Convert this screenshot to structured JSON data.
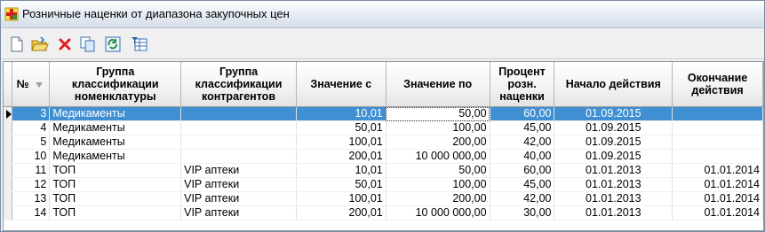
{
  "window": {
    "title": "Розничные наценки от диапазона закупочных цен"
  },
  "toolbar": {
    "buttons": [
      {
        "name": "new-icon"
      },
      {
        "name": "open-folder-icon"
      },
      {
        "name": "delete-icon"
      },
      {
        "name": "copy-icon"
      },
      {
        "name": "refresh-icon"
      },
      {
        "name": "filter-table-icon"
      }
    ]
  },
  "table": {
    "columns": [
      {
        "label": "№"
      },
      {
        "label": "Группа классификации номенклатуры"
      },
      {
        "label": "Группа классификации контрагентов"
      },
      {
        "label": "Значение с"
      },
      {
        "label": "Значение по"
      },
      {
        "label": "Процент розн. наценки"
      },
      {
        "label": "Начало действия"
      },
      {
        "label": "Окончание действия"
      }
    ],
    "selected_row": 0,
    "rows": [
      {
        "no": "3",
        "nom_group": "Медикаменты",
        "contr_group": "",
        "from": "10,01",
        "to": "50,00",
        "percent": "60,00",
        "start": "01.09.2015",
        "end": ""
      },
      {
        "no": "4",
        "nom_group": "Медикаменты",
        "contr_group": "",
        "from": "50,01",
        "to": "100,00",
        "percent": "45,00",
        "start": "01.09.2015",
        "end": ""
      },
      {
        "no": "5",
        "nom_group": "Медикаменты",
        "contr_group": "",
        "from": "100,01",
        "to": "200,00",
        "percent": "42,00",
        "start": "01.09.2015",
        "end": ""
      },
      {
        "no": "10",
        "nom_group": "Медикаменты",
        "contr_group": "",
        "from": "200,01",
        "to": "10 000 000,00",
        "percent": "40,00",
        "start": "01.09.2015",
        "end": ""
      },
      {
        "no": "11",
        "nom_group": "ТОП",
        "contr_group": "VIP аптеки",
        "from": "10,01",
        "to": "50,00",
        "percent": "60,00",
        "start": "01.01.2013",
        "end": "01.01.2014"
      },
      {
        "no": "12",
        "nom_group": "ТОП",
        "contr_group": "VIP аптеки",
        "from": "50,01",
        "to": "100,00",
        "percent": "45,00",
        "start": "01.01.2013",
        "end": "01.01.2014"
      },
      {
        "no": "13",
        "nom_group": "ТОП",
        "contr_group": "VIP аптеки",
        "from": "100,01",
        "to": "200,00",
        "percent": "42,00",
        "start": "01.01.2013",
        "end": "01.01.2014"
      },
      {
        "no": "14",
        "nom_group": "ТОП",
        "contr_group": "VIP аптеки",
        "from": "200,01",
        "to": "10 000 000,00",
        "percent": "30,00",
        "start": "01.01.2013",
        "end": "01.01.2014"
      }
    ]
  }
}
